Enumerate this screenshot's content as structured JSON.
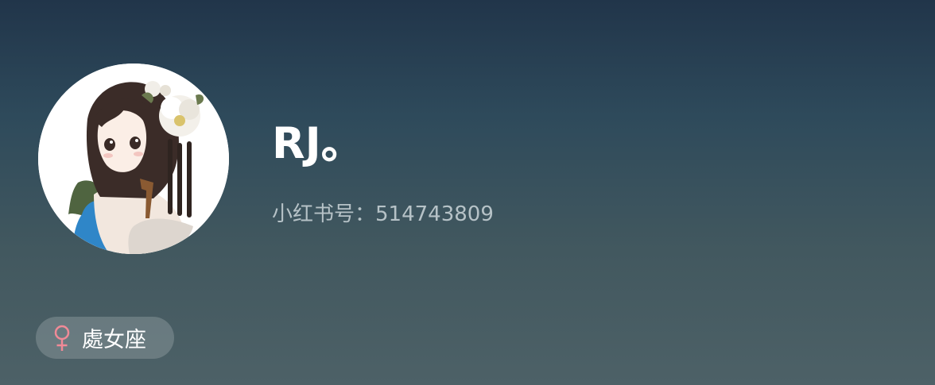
{
  "profile": {
    "nickname": "RJ。",
    "user_id_text": "小红书号：514743809",
    "avatar": {
      "icon": "user-avatar-illustration"
    },
    "zodiac_tag": {
      "icon": "female-symbol-icon",
      "label": "處女座"
    }
  },
  "colors": {
    "background_top": "#21354a",
    "background_bottom": "#4d6167",
    "nickname": "#ffffff",
    "user_id": "#b6c2c7",
    "female_symbol": "#f08a97",
    "tag_background": "rgba(255,255,255,0.18)"
  }
}
